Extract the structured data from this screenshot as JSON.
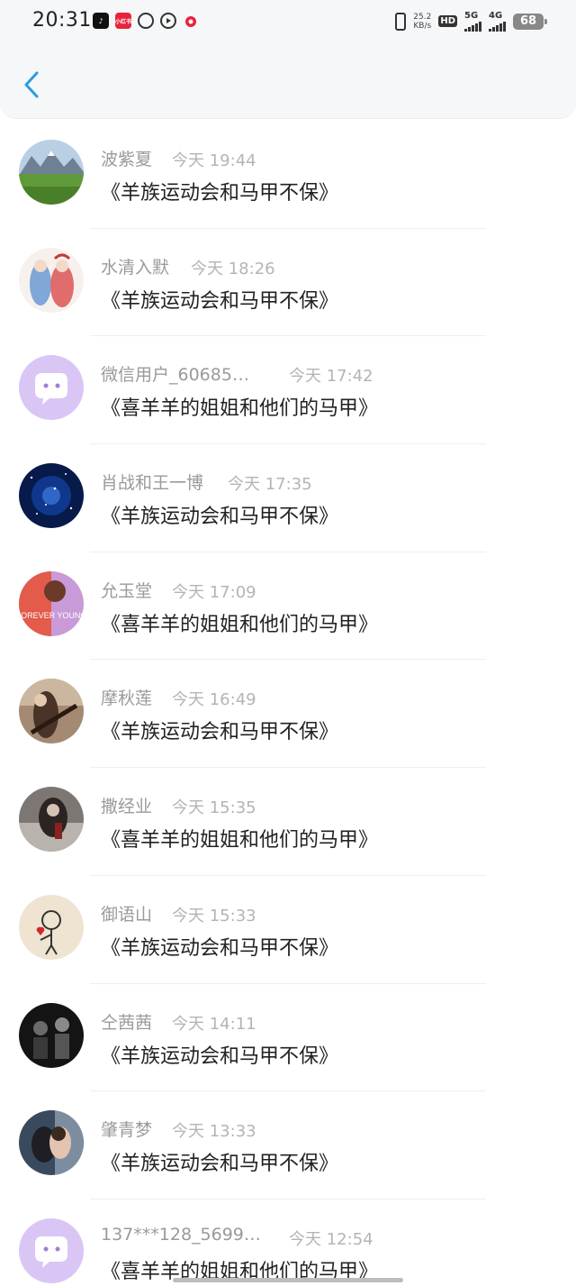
{
  "status_bar": {
    "time": "20:31",
    "net_speed_value": "25.2",
    "net_speed_unit": "KB/s",
    "hd_label": "HD",
    "sim1_label": "5G",
    "sim2_label": "4G",
    "battery": "68"
  },
  "header": {
    "back_icon": "chevron-left-icon",
    "accent_color": "#2b9be0"
  },
  "comments": [
    {
      "name": "波紫夏",
      "time": "今天 19:44",
      "message": "《羊族运动会和马甲不保》",
      "avatar": "mountain-landscape"
    },
    {
      "name": "水清入默",
      "time": "今天 18:26",
      "message": "《羊族运动会和马甲不保》",
      "avatar": "anime-girls"
    },
    {
      "name": "微信用户_60685…",
      "time": "今天 17:42",
      "message": "《喜羊羊的姐姐和他们的马甲》",
      "avatar": "default-chat-bubble"
    },
    {
      "name": "肖战和王一博",
      "time": "今天 17:35",
      "message": "《羊族运动会和马甲不保》",
      "avatar": "starry-sky"
    },
    {
      "name": "允玉堂",
      "time": "今天 17:09",
      "message": "《喜羊羊的姐姐和他们的马甲》",
      "avatar": "forever-young-art",
      "avatar_text": "FOREVER YOUNG"
    },
    {
      "name": "摩秋莲",
      "time": "今天 16:49",
      "message": "《羊族运动会和马甲不保》",
      "avatar": "guitar-player"
    },
    {
      "name": "撒经业",
      "time": "今天 15:35",
      "message": "《喜羊羊的姐姐和他们的马甲》",
      "avatar": "dark-photo"
    },
    {
      "name": "御语山",
      "time": "今天 15:33",
      "message": "《羊族运动会和马甲不保》",
      "avatar": "stick-figure-heart"
    },
    {
      "name": "仝茜茜",
      "time": "今天 14:11",
      "message": "《羊族运动会和马甲不保》",
      "avatar": "black-white-photo"
    },
    {
      "name": "肇青梦",
      "time": "今天 13:33",
      "message": "《羊族运动会和马甲不保》",
      "avatar": "couple-photo"
    },
    {
      "name": "137***128_5699…",
      "time": "今天 12:54",
      "message": "《喜羊羊的姐姐和他们的马甲》",
      "avatar": "default-chat-bubble"
    }
  ]
}
